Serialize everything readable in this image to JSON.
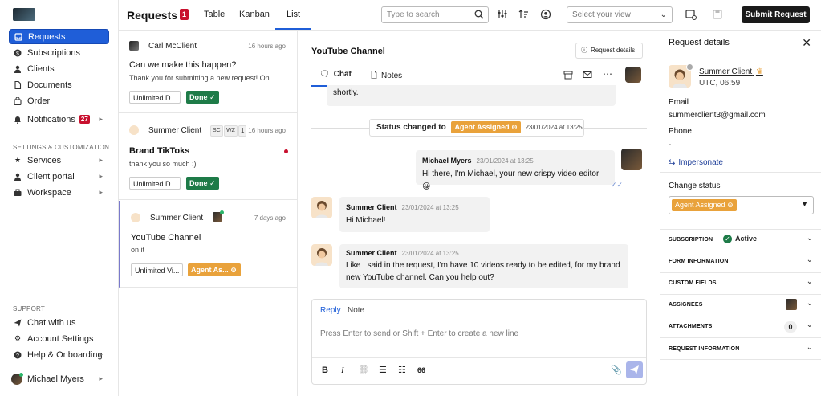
{
  "sidebar": {
    "nav": [
      {
        "label": "Requests",
        "icon": "inbox-icon"
      },
      {
        "label": "Subscriptions",
        "icon": "dollar-icon"
      },
      {
        "label": "Clients",
        "icon": "person-icon"
      },
      {
        "label": "Documents",
        "icon": "document-icon"
      },
      {
        "label": "Order",
        "icon": "bag-icon"
      }
    ],
    "notifications_label": "Notifications",
    "notifications_count": "27",
    "settings_section": "SETTINGS & CUSTOMIZATION",
    "settings": [
      {
        "label": "Services",
        "icon": "star-icon"
      },
      {
        "label": "Client portal",
        "icon": "person-icon"
      },
      {
        "label": "Workspace",
        "icon": "briefcase-icon"
      }
    ],
    "support_section": "SUPPORT",
    "support": [
      {
        "label": "Chat with us",
        "icon": "send-icon"
      },
      {
        "label": "Account Settings",
        "icon": "gear-icon"
      },
      {
        "label": "Help & Onboarding",
        "icon": "help-icon"
      }
    ],
    "user": "Michael Myers"
  },
  "topbar": {
    "title": "Requests",
    "count": "1",
    "tabs": [
      "Table",
      "Kanban",
      "List"
    ],
    "search_placeholder": "Type to search",
    "view_placeholder": "Select your view",
    "submit_label": "Submit Request"
  },
  "requests": [
    {
      "name": "Carl McClient",
      "time": "16 hours ago",
      "subject": "Can we make this happen?",
      "preview": "Thank you for submitting a new request! On...",
      "service": "Unlimited D...",
      "status": "Done"
    },
    {
      "name": "Summer Client",
      "time": "16 hours ago",
      "initials": [
        "SC",
        "WZ"
      ],
      "count": "1",
      "subject": "Brand TikToks",
      "preview": "thank you so much :)",
      "service": "Unlimited D...",
      "status": "Done"
    },
    {
      "name": "Summer Client",
      "time": "7 days ago",
      "subject": "YouTube Channel",
      "preview": "on it",
      "service": "Unlimited Vi...",
      "status": "Agent As..."
    }
  ],
  "chat": {
    "title": "YouTube Channel",
    "request_details_label": "Request details",
    "tabs": [
      "Chat",
      "Notes"
    ],
    "prev_tail": "shortly.",
    "status_prefix": "Status changed to",
    "status_value": "Agent Assigned",
    "status_time": "23/01/2024 at 13:25",
    "messages": [
      {
        "who": "Michael Myers",
        "when": "23/01/2024 at 13:25",
        "text": "Hi there, I'm Michael, your new crispy video editor 😀"
      },
      {
        "who": "Summer Client",
        "when": "23/01/2024 at 13:25",
        "text": "Hi Michael!"
      },
      {
        "who": "Summer Client",
        "when": "23/01/2024 at 13:25",
        "text": "Like I said in the request, I'm have 10 videos ready to be edited, for my brand new YouTube channel. Can you help out?"
      }
    ],
    "composer": {
      "reply_label": "Reply",
      "note_label": "Note",
      "placeholder": "Press Enter to send or Shift + Enter to create a new line"
    }
  },
  "details": {
    "title": "Request details",
    "client_name": "Summer Client",
    "client_time": "UTC, 06:59",
    "email_label": "Email",
    "email": "summerclient3@gmail.com",
    "phone_label": "Phone",
    "phone": "-",
    "impersonate_label": "Impersonate",
    "change_status_label": "Change status",
    "status_value": "Agent Assigned",
    "sections": [
      "SUBSCRIPTION",
      "FORM INFORMATION",
      "CUSTOM FIELDS",
      "ASSIGNEES",
      "ATTACHMENTS",
      "REQUEST INFORMATION"
    ],
    "subscription_status": "Active",
    "attachments_count": "0"
  },
  "colors": {
    "accent": "#1f5ed8",
    "done": "#1e7b48",
    "assigned": "#e9a23b",
    "badge": "#c8102e"
  }
}
